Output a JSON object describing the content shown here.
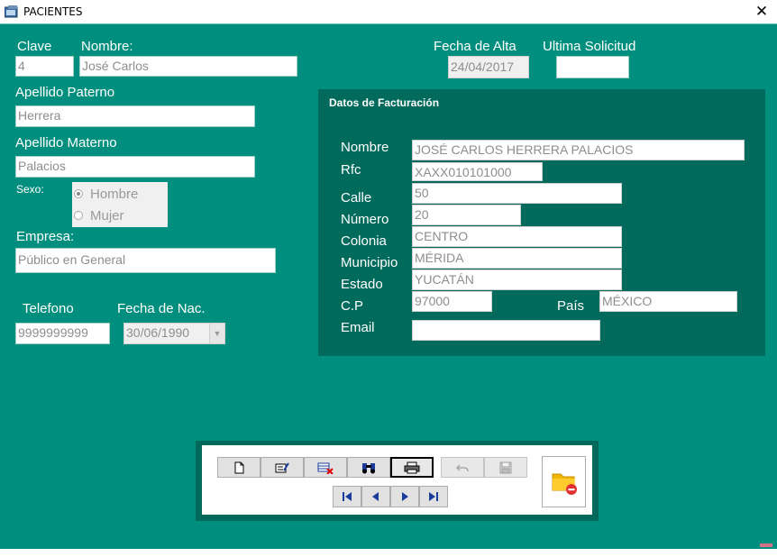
{
  "window": {
    "title": "PACIENTES",
    "close_glyph": "✕",
    "icon": "app-window-icon"
  },
  "form": {
    "clave": {
      "label": "Clave",
      "value": "4"
    },
    "nombre": {
      "label": "Nombre:",
      "value": "José Carlos"
    },
    "fecha_alta": {
      "label": "Fecha de Alta",
      "value": "24/04/2017"
    },
    "ultima_solicitud": {
      "label": "Ultima Solicitud",
      "value": ""
    },
    "apellido_paterno": {
      "label": "Apellido Paterno",
      "value": "Herrera"
    },
    "apellido_materno": {
      "label": "Apellido Materno",
      "value": "Palacios"
    },
    "sexo": {
      "label": "Sexo:",
      "options": [
        "Hombre",
        "Mujer"
      ],
      "selected": "Hombre"
    },
    "empresa": {
      "label": "Empresa:",
      "value": "Público en General"
    },
    "telefono": {
      "label": "Telefono",
      "value": "9999999999"
    },
    "fecha_nac": {
      "label": "Fecha de Nac.",
      "value": "30/06/1990"
    }
  },
  "facturacion": {
    "title": "Datos de Facturación",
    "nombre": {
      "label": "Nombre",
      "value": "JOSÉ CARLOS HERRERA PALACIOS"
    },
    "rfc": {
      "label": "Rfc",
      "value": "XAXX010101000"
    },
    "calle": {
      "label": "Calle",
      "value": "50"
    },
    "numero": {
      "label": "Número",
      "value": "20"
    },
    "colonia": {
      "label": "Colonia",
      "value": "CENTRO"
    },
    "municipio": {
      "label": "Municipio",
      "value": "MÉRIDA"
    },
    "estado": {
      "label": "Estado",
      "value": "YUCATÁN"
    },
    "cp": {
      "label": "C.P",
      "value": "97000"
    },
    "pais": {
      "label": "País",
      "value": "MÉXICO"
    },
    "email": {
      "label": "Email",
      "value": ""
    }
  },
  "toolbar": {
    "buttons": [
      {
        "icon": "new-document-icon"
      },
      {
        "icon": "edit-icon"
      },
      {
        "icon": "delete-record-icon"
      },
      {
        "icon": "search-binoculars-icon"
      },
      {
        "icon": "print-icon"
      },
      {
        "icon": "undo-icon"
      },
      {
        "icon": "save-icon"
      }
    ],
    "nav": [
      {
        "icon": "first-record-icon"
      },
      {
        "icon": "previous-record-icon"
      },
      {
        "icon": "next-record-icon"
      },
      {
        "icon": "last-record-icon"
      }
    ],
    "exit": {
      "icon": "exit-folder-icon"
    }
  },
  "colors": {
    "background": "#008f7f",
    "panel": "#006b5d",
    "label_text": "#ffffff",
    "field_text": "#8e8e8e"
  }
}
